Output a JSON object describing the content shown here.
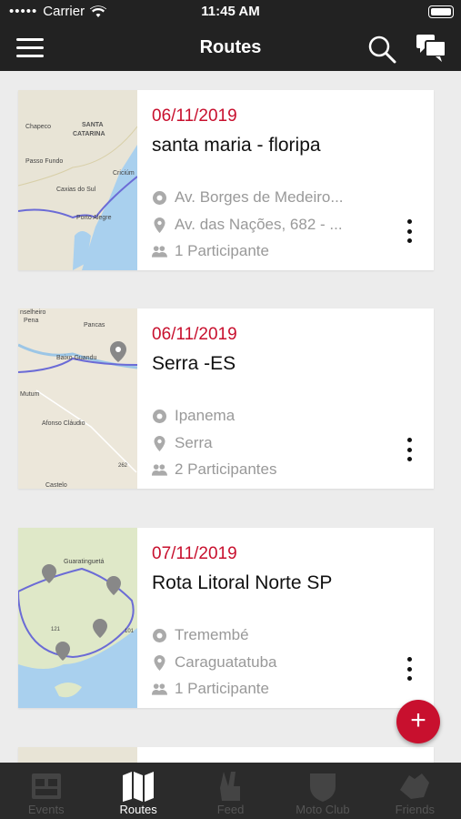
{
  "status_bar": {
    "carrier": "Carrier",
    "time": "11:45 AM"
  },
  "header": {
    "title": "Routes"
  },
  "routes": [
    {
      "date": "06/11/2019",
      "name": "santa maria - floripa",
      "start": "Av. Borges de Medeiro...",
      "end": "Av. das Nações, 682 - ...",
      "participants": "1 Participante",
      "map_labels": [
        "SANTA",
        "CATARINA",
        "Chapeco",
        "Passo Fundo",
        "Caxias do Sul",
        "Porto Alegre",
        "Criciúm"
      ]
    },
    {
      "date": "06/11/2019",
      "name": "Serra -ES",
      "start": "Ipanema",
      "end": "Serra",
      "participants": "2 Participantes",
      "map_labels": [
        "nselheiro",
        "Pena",
        "Pancas",
        "Baixo Guandu",
        "Mutum",
        "Afonso Cláudio",
        "262",
        "Castelo"
      ]
    },
    {
      "date": "07/11/2019",
      "name": "Rota Litoral Norte SP",
      "start": "Tremembé",
      "end": "Caraguatatuba",
      "participants": "1 Participante",
      "map_labels": [
        "Guaratinguetá",
        "121",
        "101"
      ]
    }
  ],
  "tabs": [
    {
      "label": "Events",
      "icon": "calendar-icon",
      "active": false
    },
    {
      "label": "Routes",
      "icon": "map-icon",
      "active": true
    },
    {
      "label": "Feed",
      "icon": "peace-hand-icon",
      "active": false
    },
    {
      "label": "Moto Club",
      "icon": "shield-icon",
      "active": false
    },
    {
      "label": "Friends",
      "icon": "handshake-icon",
      "active": false
    }
  ],
  "colors": {
    "accent": "#c8102e",
    "header_bg": "#222222",
    "content_bg": "#ececec"
  }
}
